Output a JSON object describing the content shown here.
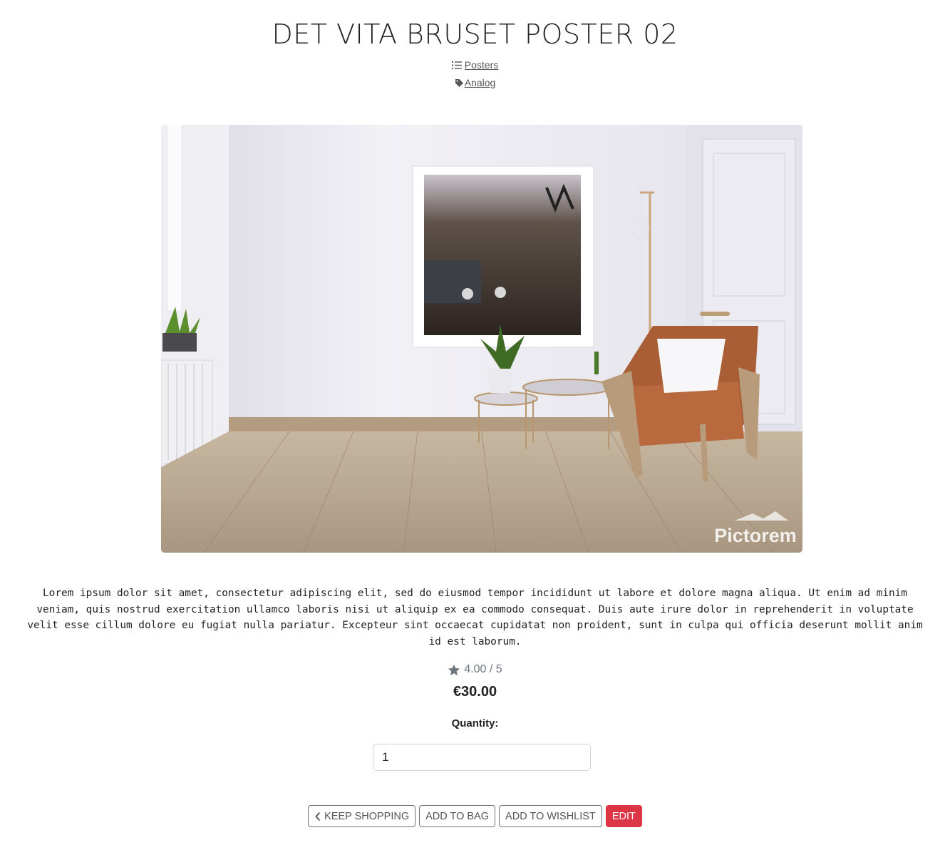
{
  "product": {
    "title": "DET VITA BRUSET POSTER 02",
    "category": "Posters",
    "tag": "Analog",
    "watermark": "Pictorem",
    "description": "Lorem ipsum dolor sit amet, consectetur adipiscing elit, sed do eiusmod tempor incididunt ut labore et dolore magna aliqua. Ut enim ad minim veniam, quis nostrud exercitation ullamco laboris nisi ut aliquip ex ea commodo consequat. Duis aute irure dolor in reprehenderit in voluptate velit esse cillum dolore eu fugiat nulla pariatur. Excepteur sint occaecat cupidatat non proident, sunt in culpa qui officia deserunt mollit anim id est laborum.",
    "rating_text": "4.00 / 5",
    "price": "€30.00",
    "quantity_label": "Quantity:",
    "quantity_value": "1"
  },
  "actions": {
    "keep_shopping": "KEEP SHOPPING",
    "add_to_bag": "ADD TO BAG",
    "add_to_wishlist": "ADD TO WISHLIST",
    "edit": "EDIT"
  },
  "icons": {
    "category": "list-icon",
    "tag": "tag-icon",
    "rating": "star-icon",
    "back": "chevron-left-icon"
  },
  "colors": {
    "danger": "#dc3545",
    "muted": "#6c757d",
    "text": "#212529"
  }
}
